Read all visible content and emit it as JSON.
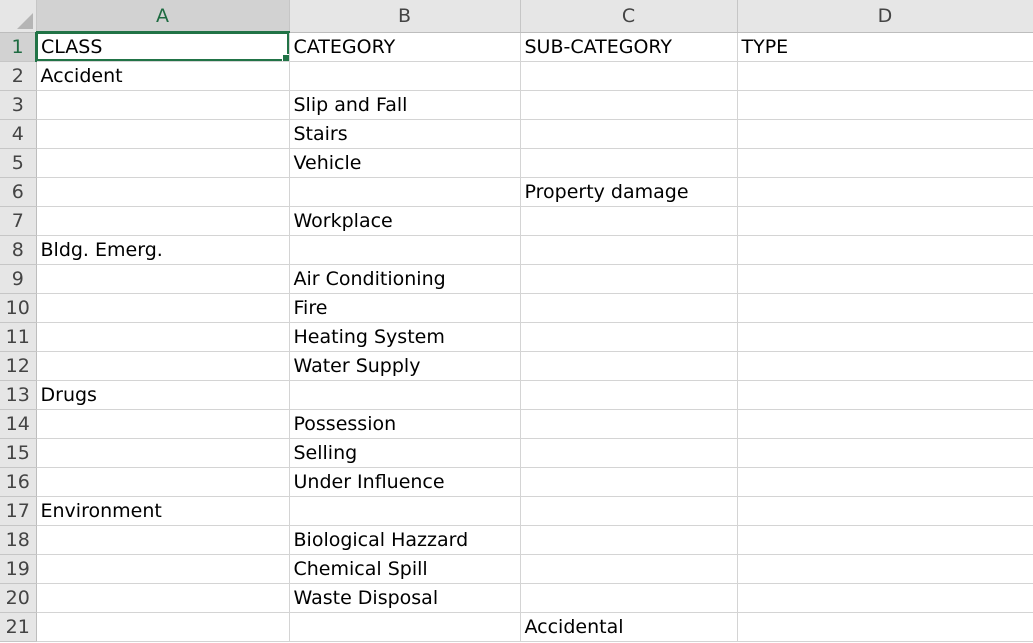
{
  "sheet": {
    "columns": [
      "A",
      "B",
      "C",
      "D"
    ],
    "active_cell": "A1",
    "rows": [
      {
        "num": "1",
        "cells": [
          "CLASS",
          "CATEGORY",
          "SUB-CATEGORY",
          "TYPE"
        ]
      },
      {
        "num": "2",
        "cells": [
          "Accident",
          "",
          "",
          ""
        ]
      },
      {
        "num": "3",
        "cells": [
          "",
          "Slip and Fall",
          "",
          ""
        ]
      },
      {
        "num": "4",
        "cells": [
          "",
          "Stairs",
          "",
          ""
        ]
      },
      {
        "num": "5",
        "cells": [
          "",
          "Vehicle",
          "",
          ""
        ]
      },
      {
        "num": "6",
        "cells": [
          "",
          "",
          "Property damage",
          ""
        ]
      },
      {
        "num": "7",
        "cells": [
          "",
          "Workplace",
          "",
          ""
        ]
      },
      {
        "num": "8",
        "cells": [
          "Bldg. Emerg.",
          "",
          "",
          ""
        ]
      },
      {
        "num": "9",
        "cells": [
          "",
          "Air Conditioning",
          "",
          ""
        ]
      },
      {
        "num": "10",
        "cells": [
          "",
          "Fire",
          "",
          ""
        ]
      },
      {
        "num": "11",
        "cells": [
          "",
          "Heating System",
          "",
          ""
        ]
      },
      {
        "num": "12",
        "cells": [
          "",
          "Water Supply",
          "",
          ""
        ]
      },
      {
        "num": "13",
        "cells": [
          "Drugs",
          "",
          "",
          ""
        ]
      },
      {
        "num": "14",
        "cells": [
          "",
          "Possession",
          "",
          ""
        ]
      },
      {
        "num": "15",
        "cells": [
          "",
          "Selling",
          "",
          ""
        ]
      },
      {
        "num": "16",
        "cells": [
          "",
          "Under Influence",
          "",
          ""
        ]
      },
      {
        "num": "17",
        "cells": [
          "Environment",
          "",
          "",
          ""
        ]
      },
      {
        "num": "18",
        "cells": [
          "",
          "Biological Hazzard",
          "",
          ""
        ]
      },
      {
        "num": "19",
        "cells": [
          "",
          "Chemical Spill",
          "",
          ""
        ]
      },
      {
        "num": "20",
        "cells": [
          "",
          "Waste Disposal",
          "",
          ""
        ]
      },
      {
        "num": "21",
        "cells": [
          "",
          "",
          "Accidental",
          ""
        ]
      }
    ]
  },
  "colors": {
    "accent": "#217346",
    "header_bg": "#e6e6e6",
    "selected_header_bg": "#d2d2d2",
    "gridline": "#d4d4d4"
  }
}
